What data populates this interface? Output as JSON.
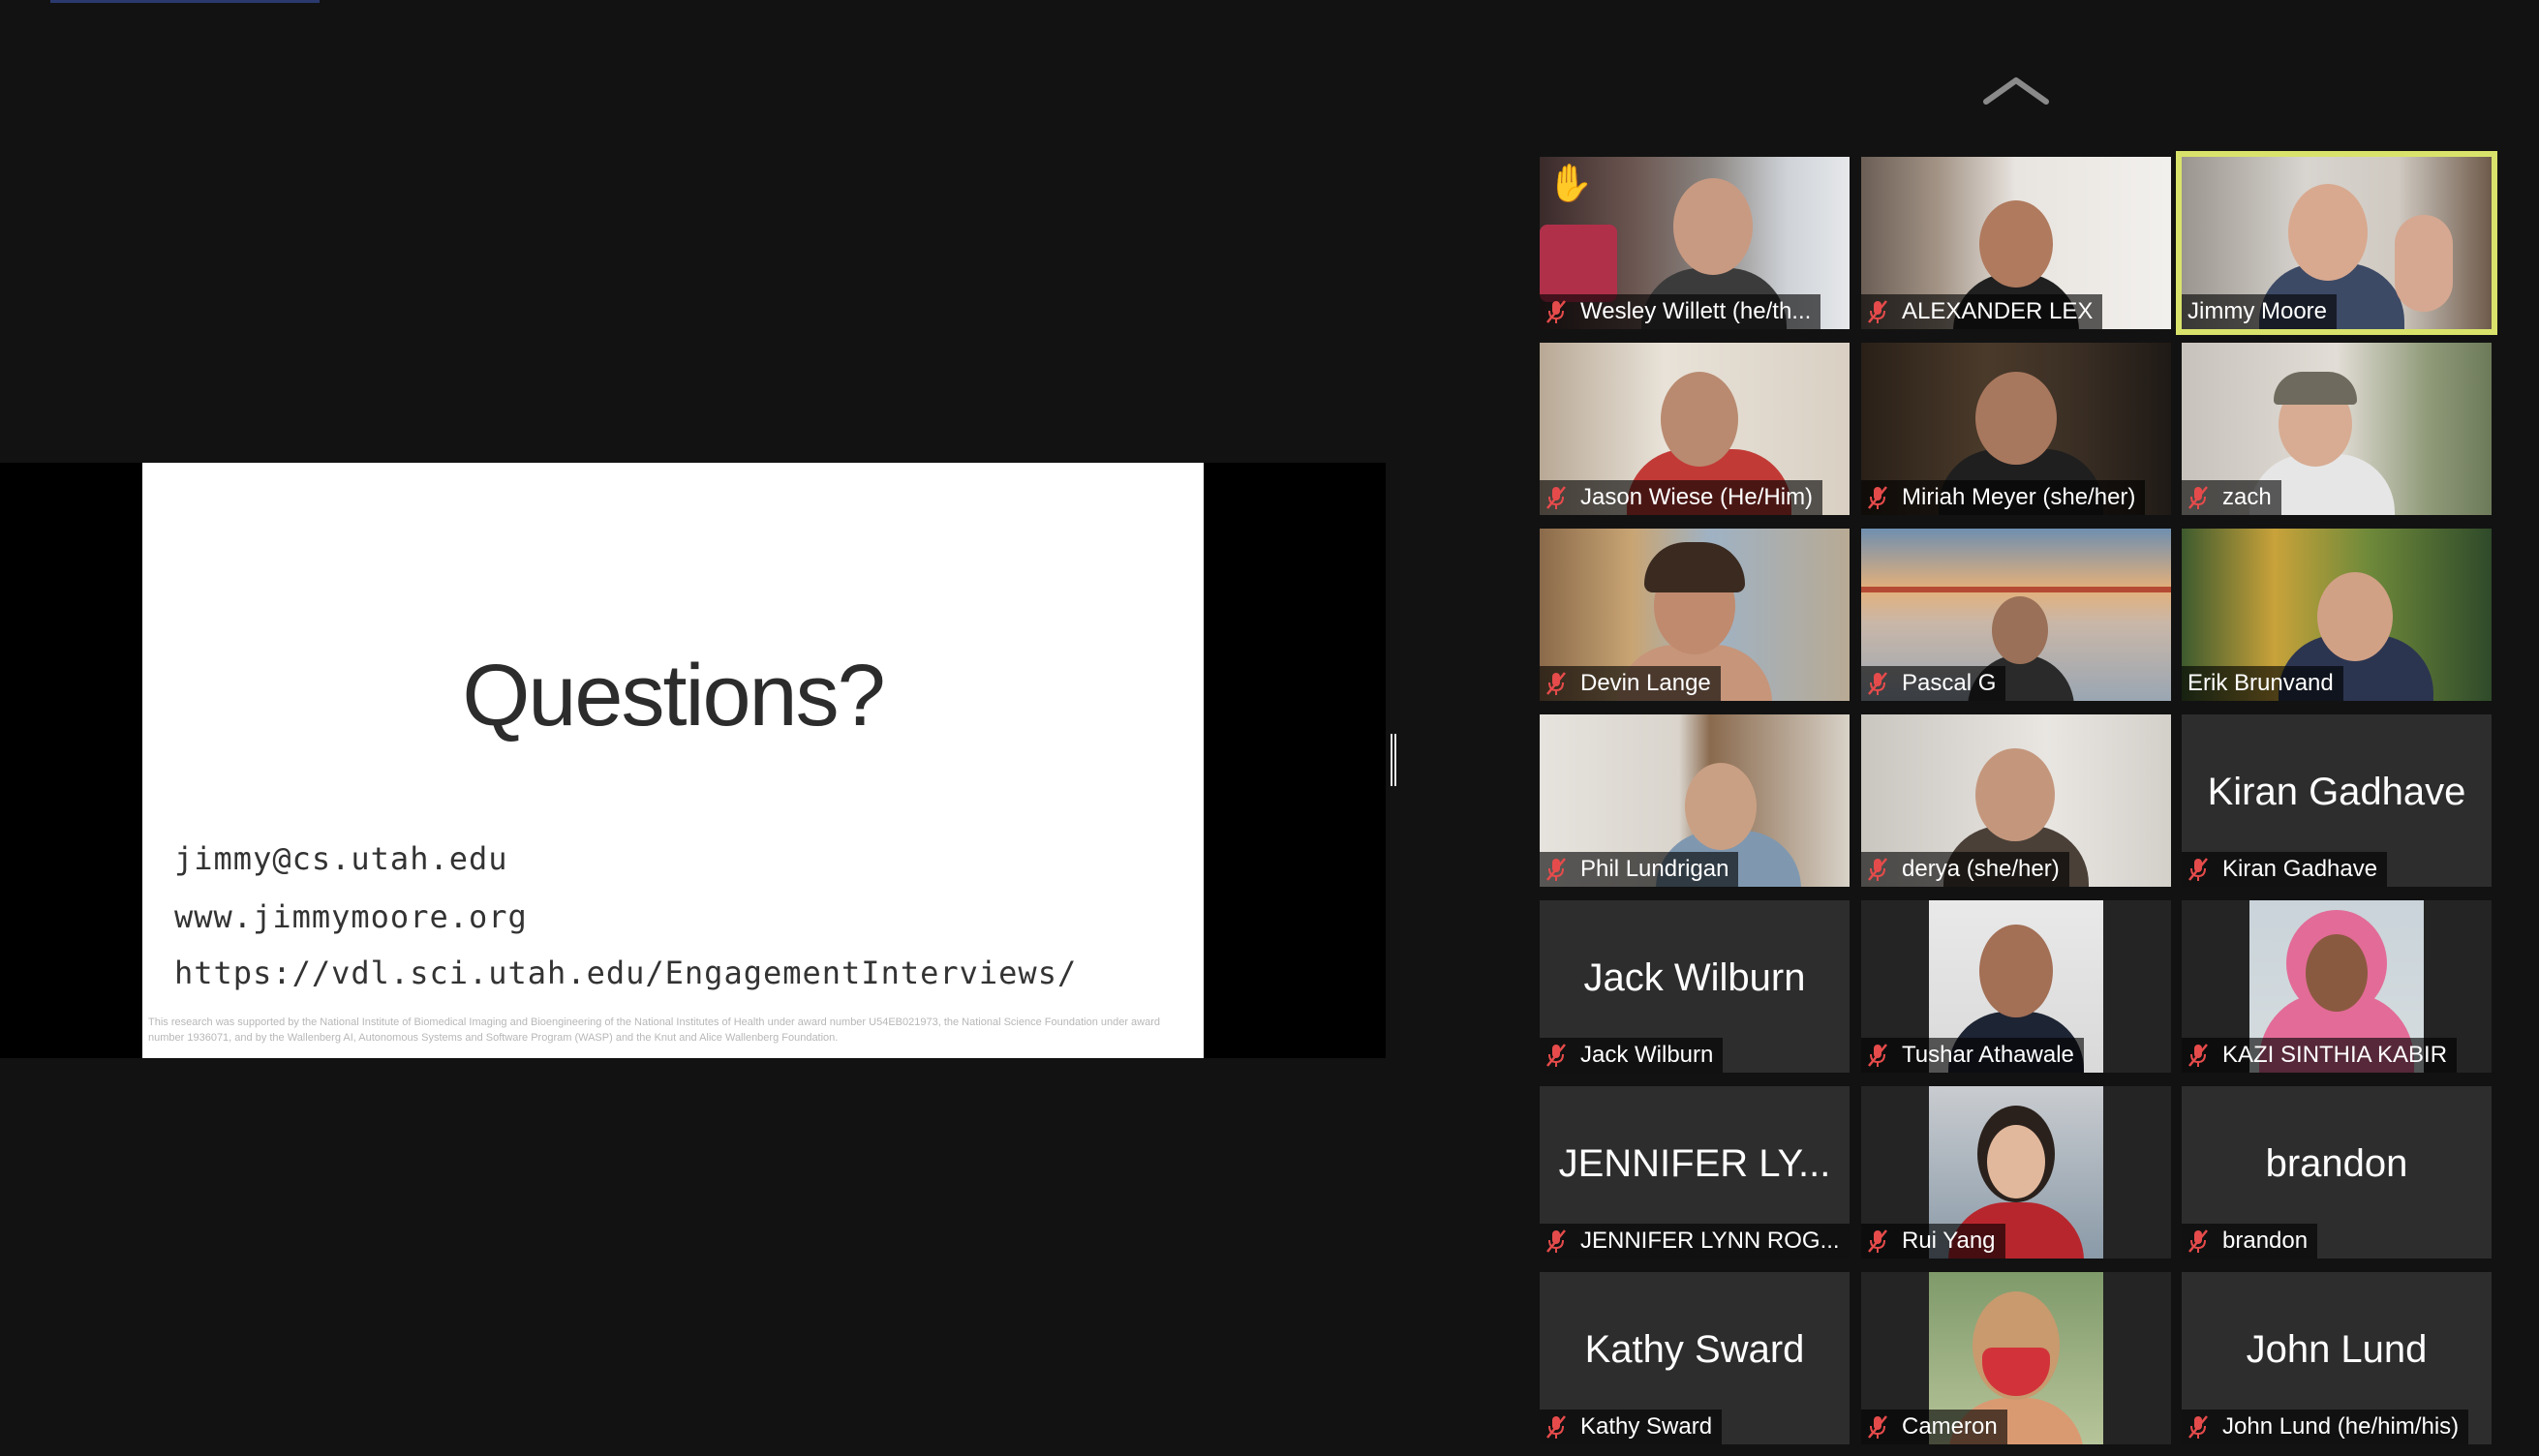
{
  "colors": {
    "background": "#121212",
    "active_speaker_outline": "#d9e36b",
    "muted_mic": "#e64b4b",
    "slide_bg": "#ffffff"
  },
  "slide": {
    "title": "Questions?",
    "email": "jimmy@cs.utah.edu",
    "website": "www.jimmymoore.org",
    "url": "https://vdl.sci.utah.edu/EngagementInterviews/",
    "footer": "This research was supported by the National Institute of Biomedical Imaging and Bioengineering of the National Institutes of Health under award number U54EB021973, the National Science Foundation under award number 1936071, and by the Wallenberg AI, Autonomous Systems and Software Program (WASP) and the Knut and Alice Wallenberg Foundation."
  },
  "gallery": {
    "scroll_up_icon": "chevron-up-icon",
    "participants": [
      {
        "label": "Wesley Willett  (he/th...",
        "muted": true,
        "type": "video",
        "hand_raised": true
      },
      {
        "label": "ALEXANDER LEX",
        "muted": true,
        "type": "video"
      },
      {
        "label": "Jimmy Moore",
        "muted": false,
        "type": "video",
        "active_speaker": true
      },
      {
        "label": "Jason Wiese  (He/Him)",
        "muted": true,
        "type": "video"
      },
      {
        "label": "Miriah Meyer (she/her)",
        "muted": true,
        "type": "video"
      },
      {
        "label": "zach",
        "muted": true,
        "type": "video"
      },
      {
        "label": "Devin Lange",
        "muted": true,
        "type": "video"
      },
      {
        "label": "Pascal G",
        "muted": true,
        "type": "video"
      },
      {
        "label": "Erik Brunvand",
        "muted": false,
        "type": "video"
      },
      {
        "label": "Phil Lundrigan",
        "muted": true,
        "type": "video"
      },
      {
        "label": "derya (she/her)",
        "muted": true,
        "type": "video"
      },
      {
        "label": "Kiran Gadhave",
        "display_name": "Kiran Gadhave",
        "muted": true,
        "type": "name"
      },
      {
        "label": "Jack Wilburn",
        "display_name": "Jack Wilburn",
        "muted": true,
        "type": "name"
      },
      {
        "label": "Tushar Athawale",
        "muted": true,
        "type": "photo"
      },
      {
        "label": "KAZI SINTHIA KABIR",
        "muted": true,
        "type": "photo"
      },
      {
        "label": "JENNIFER LYNN ROG...",
        "display_name": "JENNIFER LY...",
        "muted": true,
        "type": "name"
      },
      {
        "label": "Rui Yang",
        "muted": true,
        "type": "photo"
      },
      {
        "label": "brandon",
        "display_name": "brandon",
        "muted": true,
        "type": "name"
      },
      {
        "label": "Kathy Sward",
        "display_name": "Kathy Sward",
        "muted": true,
        "type": "name"
      },
      {
        "label": "Cameron",
        "muted": true,
        "type": "photo"
      },
      {
        "label": "John Lund  (he/him/his)",
        "display_name": "John Lund",
        "muted": true,
        "type": "name"
      }
    ]
  }
}
